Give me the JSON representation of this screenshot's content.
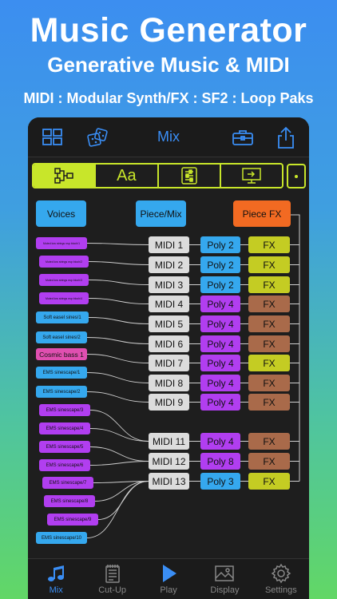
{
  "hero": {
    "title": "Music Generator",
    "subtitle": "Generative Music & MIDI",
    "tagline": "MIDI : Modular Synth/FX : SF2 : Loop Paks"
  },
  "navbar": {
    "title": "Mix"
  },
  "segments": [
    {
      "icon": "routing-icon",
      "active": true
    },
    {
      "label": "Aa",
      "active": false
    },
    {
      "icon": "mixer-sliders-icon",
      "active": false
    },
    {
      "icon": "export-screen-icon",
      "active": false
    }
  ],
  "headers": {
    "voices": "Voices",
    "piece_mix": "Piece/Mix",
    "piece_fx": "Piece FX"
  },
  "voices": [
    {
      "label": "Muted low strings nsp bloch/1",
      "color": "#b13ef0"
    },
    {
      "label": "Muted low strings nsp bloch/2",
      "color": "#b13ef0"
    },
    {
      "label": "Muted low strings nsp bloch/3",
      "color": "#b13ef0"
    },
    {
      "label": "Muted low strings nsp bloch/4",
      "color": "#b13ef0"
    },
    {
      "label": "Soft easel sines/1",
      "color": "#35a8ee"
    },
    {
      "label": "Soft easel sines/2",
      "color": "#35a8ee"
    },
    {
      "label": "Cosmic bass 1",
      "color": "#e04fb0"
    },
    {
      "label": "EMS sinescape/1",
      "color": "#35a8ee"
    },
    {
      "label": "EMS sinescape/2",
      "color": "#35a8ee"
    },
    {
      "label": "EMS sinescape/3",
      "color": "#b13ef0"
    },
    {
      "label": "EMS sinescape/4",
      "color": "#b13ef0"
    },
    {
      "label": "EMS sinescape/5",
      "color": "#b13ef0"
    },
    {
      "label": "EMS sinescape/6",
      "color": "#b13ef0"
    },
    {
      "label": "EMS sinescape/7",
      "color": "#b13ef0"
    },
    {
      "label": "EMS sinescape/8",
      "color": "#b13ef0"
    },
    {
      "label": "EMS sinescape/9",
      "color": "#b13ef0"
    },
    {
      "label": "EMS sinescape/10",
      "color": "#35a8ee"
    }
  ],
  "channels": [
    {
      "midi": "MIDI 1",
      "poly": "Poly 2",
      "poly_color": "blue",
      "fx": "FX",
      "fx_color": "yellow"
    },
    {
      "midi": "MIDI 2",
      "poly": "Poly 2",
      "poly_color": "blue",
      "fx": "FX",
      "fx_color": "yellow"
    },
    {
      "midi": "MIDI 3",
      "poly": "Poly 2",
      "poly_color": "blue",
      "fx": "FX",
      "fx_color": "yellow"
    },
    {
      "midi": "MIDI 4",
      "poly": "Poly 4",
      "poly_color": "purple",
      "fx": "FX",
      "fx_color": "brown"
    },
    {
      "midi": "MIDI 5",
      "poly": "Poly 4",
      "poly_color": "purple",
      "fx": "FX",
      "fx_color": "brown"
    },
    {
      "midi": "MIDI 6",
      "poly": "Poly 4",
      "poly_color": "purple",
      "fx": "FX",
      "fx_color": "brown"
    },
    {
      "midi": "MIDI 7",
      "poly": "Poly 4",
      "poly_color": "purple",
      "fx": "FX",
      "fx_color": "yellow"
    },
    {
      "midi": "MIDI 8",
      "poly": "Poly 4",
      "poly_color": "purple",
      "fx": "FX",
      "fx_color": "brown"
    },
    {
      "midi": "MIDI 9",
      "poly": "Poly 4",
      "poly_color": "purple",
      "fx": "FX",
      "fx_color": "brown"
    },
    {
      "midi": "MIDI 11",
      "poly": "Poly 4",
      "poly_color": "purple",
      "fx": "FX",
      "fx_color": "brown"
    },
    {
      "midi": "MIDI 12",
      "poly": "Poly 8",
      "poly_color": "purple",
      "fx": "FX",
      "fx_color": "brown"
    },
    {
      "midi": "MIDI 13",
      "poly": "Poly 3",
      "poly_color": "blue",
      "fx": "FX",
      "fx_color": "yellow"
    }
  ],
  "colors": {
    "accent": "#3a8ef5",
    "lime": "#c8e62a",
    "voices_button": "#35a8ee",
    "piece_mix_button": "#35a8ee",
    "piece_fx_button": "#f26a22"
  },
  "tabs": [
    {
      "label": "Mix",
      "icon": "music-note-icon",
      "active": true
    },
    {
      "label": "Cut-Up",
      "icon": "notepad-icon",
      "active": false
    },
    {
      "label": "Play",
      "icon": "play-icon",
      "active": false
    },
    {
      "label": "Display",
      "icon": "image-icon",
      "active": false
    },
    {
      "label": "Settings",
      "icon": "gear-icon",
      "active": false
    }
  ]
}
